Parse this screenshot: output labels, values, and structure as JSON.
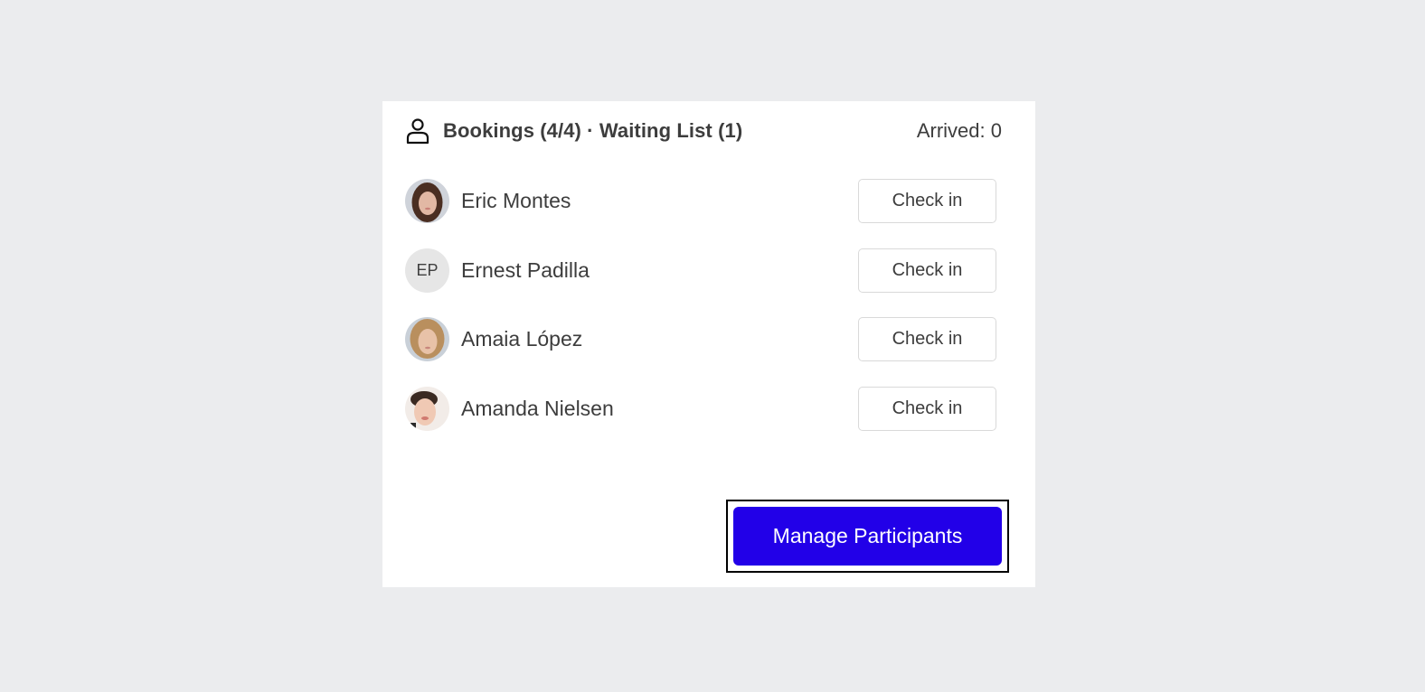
{
  "header": {
    "icon": "user-icon",
    "title": "Bookings (4/4) · Waiting List (1)",
    "arrived": "Arrived: 0"
  },
  "participants": [
    {
      "name": "Eric Montes",
      "avatar": "photo",
      "avatar_palette": {
        "bg": "#cfd3da",
        "hair": "#4a2e22",
        "skin": "#e2b8a4"
      },
      "action": "Check in"
    },
    {
      "name": "Ernest Padilla",
      "avatar": "initials",
      "initials": "EP",
      "action": "Check in"
    },
    {
      "name": "Amaia López",
      "avatar": "photo",
      "avatar_palette": {
        "bg": "#c9d0d8",
        "hair": "#b98f5e",
        "skin": "#e8c2a8"
      },
      "action": "Check in"
    },
    {
      "name": "Amanda Nielsen",
      "avatar": "photo",
      "avatar_palette": {
        "bg": "#f2ece8",
        "hair": "#3b2a22",
        "skin": "#f0c9b4"
      },
      "action": "Check in"
    }
  ],
  "footer": {
    "manage_label": "Manage Participants",
    "accent": "#2200e8"
  }
}
